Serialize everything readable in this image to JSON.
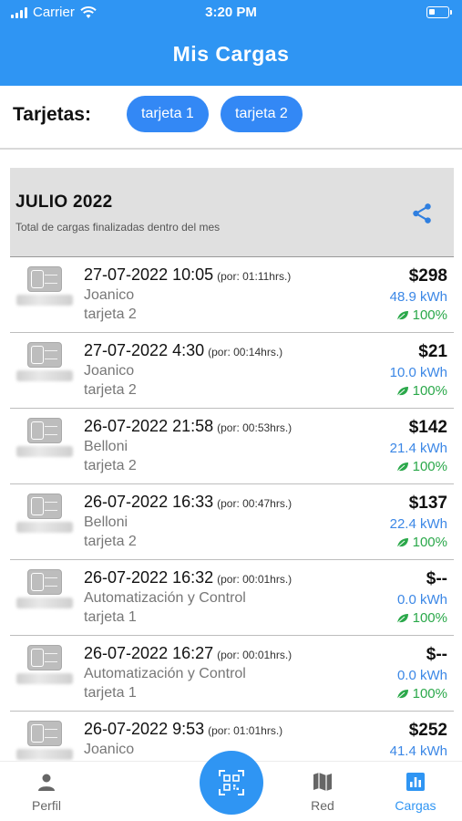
{
  "status_bar": {
    "carrier": "Carrier",
    "time": "3:20 PM"
  },
  "header": {
    "title": "Mis Cargas"
  },
  "cards": {
    "label": "Tarjetas:",
    "chips": [
      "tarjeta 1",
      "tarjeta 2"
    ]
  },
  "month": {
    "title": "JULIO 2022",
    "subtitle": "Total de cargas finalizadas dentro del mes"
  },
  "charges": [
    {
      "date": "27-07-2022 10:05",
      "duration": "(por: 01:11hrs.)",
      "place": "Joanico",
      "card": "tarjeta 2",
      "price": "$298",
      "kwh": "48.9 kWh",
      "green": "100%"
    },
    {
      "date": "27-07-2022 4:30",
      "duration": "(por: 00:14hrs.)",
      "place": "Joanico",
      "card": "tarjeta 2",
      "price": "$21",
      "kwh": "10.0 kWh",
      "green": "100%"
    },
    {
      "date": "26-07-2022 21:58",
      "duration": "(por: 00:53hrs.)",
      "place": "Belloni",
      "card": "tarjeta 2",
      "price": "$142",
      "kwh": "21.4 kWh",
      "green": "100%"
    },
    {
      "date": "26-07-2022 16:33",
      "duration": "(por: 00:47hrs.)",
      "place": "Belloni",
      "card": "tarjeta 2",
      "price": "$137",
      "kwh": "22.4 kWh",
      "green": "100%"
    },
    {
      "date": "26-07-2022 16:32",
      "duration": "(por: 00:01hrs.)",
      "place": "Automatización y Control",
      "card": "tarjeta 1",
      "price": "$--",
      "kwh": "0.0 kWh",
      "green": "100%"
    },
    {
      "date": "26-07-2022 16:27",
      "duration": "(por: 00:01hrs.)",
      "place": "Automatización y Control",
      "card": "tarjeta 1",
      "price": "$--",
      "kwh": "0.0 kWh",
      "green": "100%"
    },
    {
      "date": "26-07-2022 9:53",
      "duration": "(por: 01:01hrs.)",
      "place": "Joanico",
      "card": "",
      "price": "$252",
      "kwh": "41.4 kWh",
      "green": ""
    }
  ],
  "nav": {
    "perfil": "Perfil",
    "red": "Red",
    "cargas": "Cargas"
  },
  "colors": {
    "primary": "#2f95f3",
    "chip": "#3388f5",
    "kwh": "#3b87e6",
    "green": "#2aa84a"
  },
  "icons": {
    "share": "share-icon",
    "charger": "charger-icon",
    "leaf": "leaf-icon",
    "qr": "qr-code-icon",
    "person": "person-icon",
    "map": "map-icon",
    "chart": "bar-chart-icon"
  }
}
